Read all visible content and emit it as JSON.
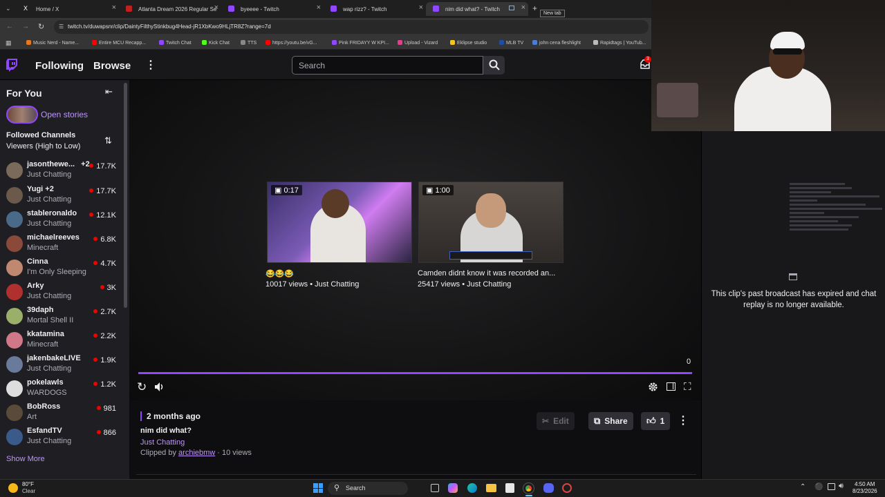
{
  "browser": {
    "tabs": [
      {
        "title": "Home / X",
        "color": "#111111"
      },
      {
        "title": "Atlanta Dream 2026 Regular Se",
        "color": "#c21f1f"
      },
      {
        "title": "byeeee - Twitch",
        "color": "#9147ff"
      },
      {
        "title": "wap rizz? - Twitch",
        "color": "#9147ff"
      },
      {
        "title": "nim did what? - Twitch",
        "color": "#9147ff"
      }
    ],
    "new_tab_tooltip": "New tab",
    "url": "twitch.tv/duwapsnr/clip/DaintyFilthyStinkbug4Head-jR1XbKwo9HLjTR8Z?range=7d",
    "bookmarks": [
      {
        "label": "Music Nerd - Name...",
        "color": "#e87722"
      },
      {
        "label": "Entire MCU Recapp...",
        "color": "#ff0000"
      },
      {
        "label": "Twitch Chat",
        "color": "#9147ff"
      },
      {
        "label": "Kick Chat",
        "color": "#53fc18"
      },
      {
        "label": "TTS",
        "color": "#888888"
      },
      {
        "label": "https://youtu.be/vG...",
        "color": "#ff0000"
      },
      {
        "label": "Pink FRIDAYY W KPI...",
        "color": "#9147ff"
      },
      {
        "label": "Upload - Vizard",
        "color": "#e0408a"
      },
      {
        "label": "Eklipse studio",
        "color": "#f5c518"
      },
      {
        "label": "MLB TV",
        "color": "#1d4ea8"
      },
      {
        "label": "john cena fleshlight",
        "color": "#4a7dd8"
      },
      {
        "label": "Rapidtags | YouTub...",
        "color": "#bbbbbb"
      }
    ]
  },
  "nav": {
    "following": "Following",
    "browse": "Browse",
    "search_placeholder": "Search",
    "notif_count": "3"
  },
  "sidebar": {
    "for_you": "For You",
    "open_stories": "Open stories",
    "followed_title": "Followed Channels",
    "followed_sub": "Viewers (High to Low)",
    "channels": [
      {
        "name": "jasonthewe...",
        "extra": "+2",
        "game": "Just Chatting",
        "viewers": "17.7K",
        "color": "#7a6a5a"
      },
      {
        "name": "Yugi +2",
        "extra": "",
        "game": "Just Chatting",
        "viewers": "17.7K",
        "color": "#6b5a4b"
      },
      {
        "name": "stableronaldo",
        "extra": "",
        "game": "Just Chatting",
        "viewers": "12.1K",
        "color": "#4a6a8a"
      },
      {
        "name": "michaelreeves",
        "extra": "",
        "game": "Minecraft",
        "viewers": "6.8K",
        "color": "#8a4a3a"
      },
      {
        "name": "Cinna",
        "extra": "",
        "game": "I'm Only Sleeping",
        "viewers": "4.7K",
        "color": "#c08870"
      },
      {
        "name": "Arky",
        "extra": "",
        "game": "Just Chatting",
        "viewers": "3K",
        "color": "#b03030"
      },
      {
        "name": "39daph",
        "extra": "",
        "game": "Mortal Shell II",
        "viewers": "2.7K",
        "color": "#9ab06a"
      },
      {
        "name": "kkatamina",
        "extra": "",
        "game": "Minecraft",
        "viewers": "2.2K",
        "color": "#d07888"
      },
      {
        "name": "jakenbakeLIVE",
        "extra": "",
        "game": "Just Chatting",
        "viewers": "1.9K",
        "color": "#6a7a9a"
      },
      {
        "name": "pokelawls",
        "extra": "",
        "game": "WARDOGS",
        "viewers": "1.2K",
        "color": "#dddddd"
      },
      {
        "name": "BobRoss",
        "extra": "",
        "game": "Art",
        "viewers": "981",
        "color": "#5a4a3a"
      },
      {
        "name": "EsfandTV",
        "extra": "",
        "game": "Just Chatting",
        "viewers": "866",
        "color": "#3a5a8a"
      }
    ],
    "show_more": "Show More"
  },
  "player": {
    "suggestions": [
      {
        "duration": "0:17",
        "title": "😂😂😂",
        "meta": "10017 views • Just Chatting"
      },
      {
        "duration": "1:00",
        "title": "Camden didnt know it was recorded an...",
        "meta": "25417 views • Just Chatting"
      }
    ],
    "time_readout": "0",
    "progress": 1.0
  },
  "clip": {
    "age": "2 months ago",
    "title": "nim did what?",
    "category": "Just Chatting",
    "clipped_by_prefix": "Clipped by",
    "clipper": "archiebmw",
    "views": "· 10 views",
    "edit": "Edit",
    "share": "Share",
    "likes": "1"
  },
  "chat": {
    "expired_message": "This clip's past broadcast has expired and chat replay is no longer available."
  },
  "taskbar": {
    "temp": "80°F",
    "weather": "Clear",
    "search": "Search",
    "time": "4:50 AM",
    "date": "8/23/2026"
  },
  "colors": {
    "twitch_purple": "#9147ff",
    "live_red": "#eb0400"
  }
}
